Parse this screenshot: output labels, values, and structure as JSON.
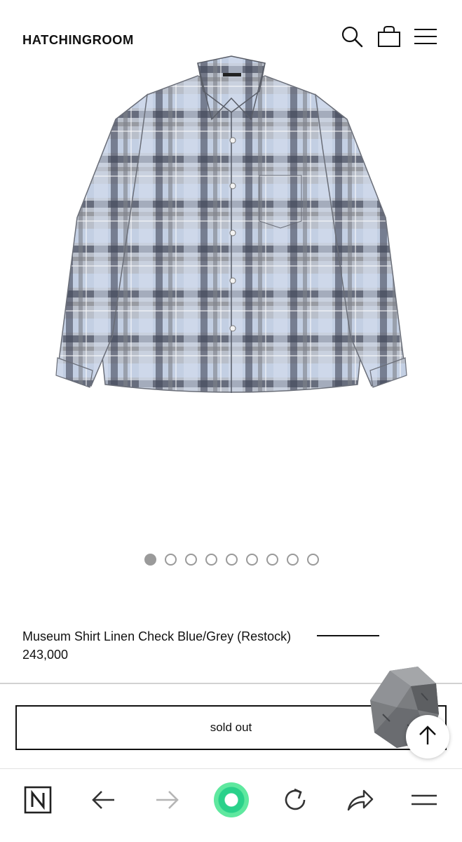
{
  "header": {
    "brand": "HATCHINGROOM",
    "icons": [
      "search-icon",
      "shopping-bag-icon",
      "hamburger-menu-icon"
    ]
  },
  "product": {
    "image": "plaid-linen-shirt",
    "title": "Museum Shirt Linen Check Blue/Grey (Restock)",
    "price": "243,000",
    "carousel": {
      "total": 9,
      "active": 1
    },
    "button_label": "sold out"
  },
  "floating": {
    "icons": [
      "rock-sticker-icon",
      "arrow-up-icon"
    ]
  },
  "browser_bar": {
    "icons": [
      "naver-n-icon",
      "back-arrow-icon",
      "forward-arrow-icon",
      "home-circle-icon",
      "reload-icon",
      "share-icon",
      "menu-icon"
    ]
  },
  "colors": {
    "text": "#111111",
    "dot": "#9a9a9a",
    "divider": "#d2d2d2",
    "accent_green": "#29d18a"
  }
}
